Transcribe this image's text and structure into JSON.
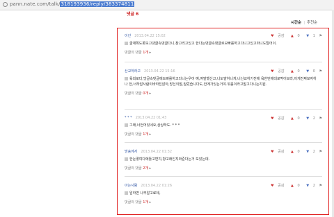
{
  "browser": {
    "url_prefix": "pann.nate.com/talk/",
    "url_highlight": "318193936/reply/383374811"
  },
  "header": {
    "title": "댓글 6",
    "sort_latest": "시간순",
    "sort_recommend": "추천순"
  },
  "comments": [
    {
      "author": "이넌",
      "date": "2013.04.22 15:02",
      "text": "글재목도못보고댓글속댓글다니,창고리고있고 한다는댓글속댓글로모빠롤하고다니고있고마니도탈어이.",
      "like": "공감",
      "up": "0",
      "down": "1",
      "reply_label": "댓글의 댓글",
      "reply_count": "1개"
    },
    {
      "author": "산교하라고",
      "date": "2013.04.22 15:16",
      "text": "육회로다,맛글속댓글에도빠롤하고다니는우어 예,여발했신고,나도발하니게,너산교하기전에 육한번에대로먹어보라,이게진짜보자하나 전,너하잡사람이바하진않아,방신의말,질렀습니다도,한계가있는거야.뭐롤이라고말고다니는지원.",
      "like": "공감",
      "up": "0",
      "down": "0",
      "reply_label": "댓글의 댓글",
      "reply_count": "0개"
    },
    {
      "author": "* * *",
      "date": "2013.04.22 01:43",
      "text": "그래,너언어있네요,상상하도. * * *",
      "like": "공감",
      "up": "0",
      "down": "2",
      "reply_label": "댓글의 댓글",
      "reply_count": "1개"
    },
    {
      "author": "방송에서",
      "date": "2013.04.22 01:32",
      "text": "한눈떻여다에툴고면지,항고래인지와준다는거 보았는데.",
      "like": "공감",
      "up": "0",
      "down": "2",
      "reply_label": "댓글의 댓글",
      "reply_count": "2개"
    },
    {
      "author": "아는사람",
      "date": "2013.04.22 01:26",
      "text": "임하면 나무알고료데,",
      "like": "공감",
      "up": "0",
      "down": "2",
      "reply_label": "댓글의 댓글",
      "reply_count": "1개"
    }
  ]
}
